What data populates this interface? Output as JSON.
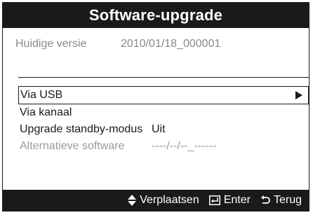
{
  "title": "Software-upgrade",
  "version": {
    "label": "Huidige versie",
    "value": "2010/01/18_000001"
  },
  "menu": {
    "items": [
      {
        "label": "Via USB",
        "value": "",
        "selected": true,
        "disabled": false
      },
      {
        "label": "Via kanaal",
        "value": "",
        "selected": false,
        "disabled": false
      },
      {
        "label": "Upgrade standby-modus",
        "value": "Uit",
        "selected": false,
        "disabled": false
      },
      {
        "label": "Alternatieve software",
        "value": "----/--/--_------",
        "selected": false,
        "disabled": true
      }
    ]
  },
  "footer": {
    "move_label": "Verplaatsen",
    "enter_label": "Enter",
    "return_label": "Terug",
    "move_icon": "up-down-arrows-icon",
    "enter_icon": "enter-icon",
    "return_icon": "return-arrow-icon"
  },
  "colors": {
    "bar": "#1a1a1a",
    "text": "#1a1a1a",
    "muted": "#8a8a8a",
    "background": "#ffffff"
  }
}
